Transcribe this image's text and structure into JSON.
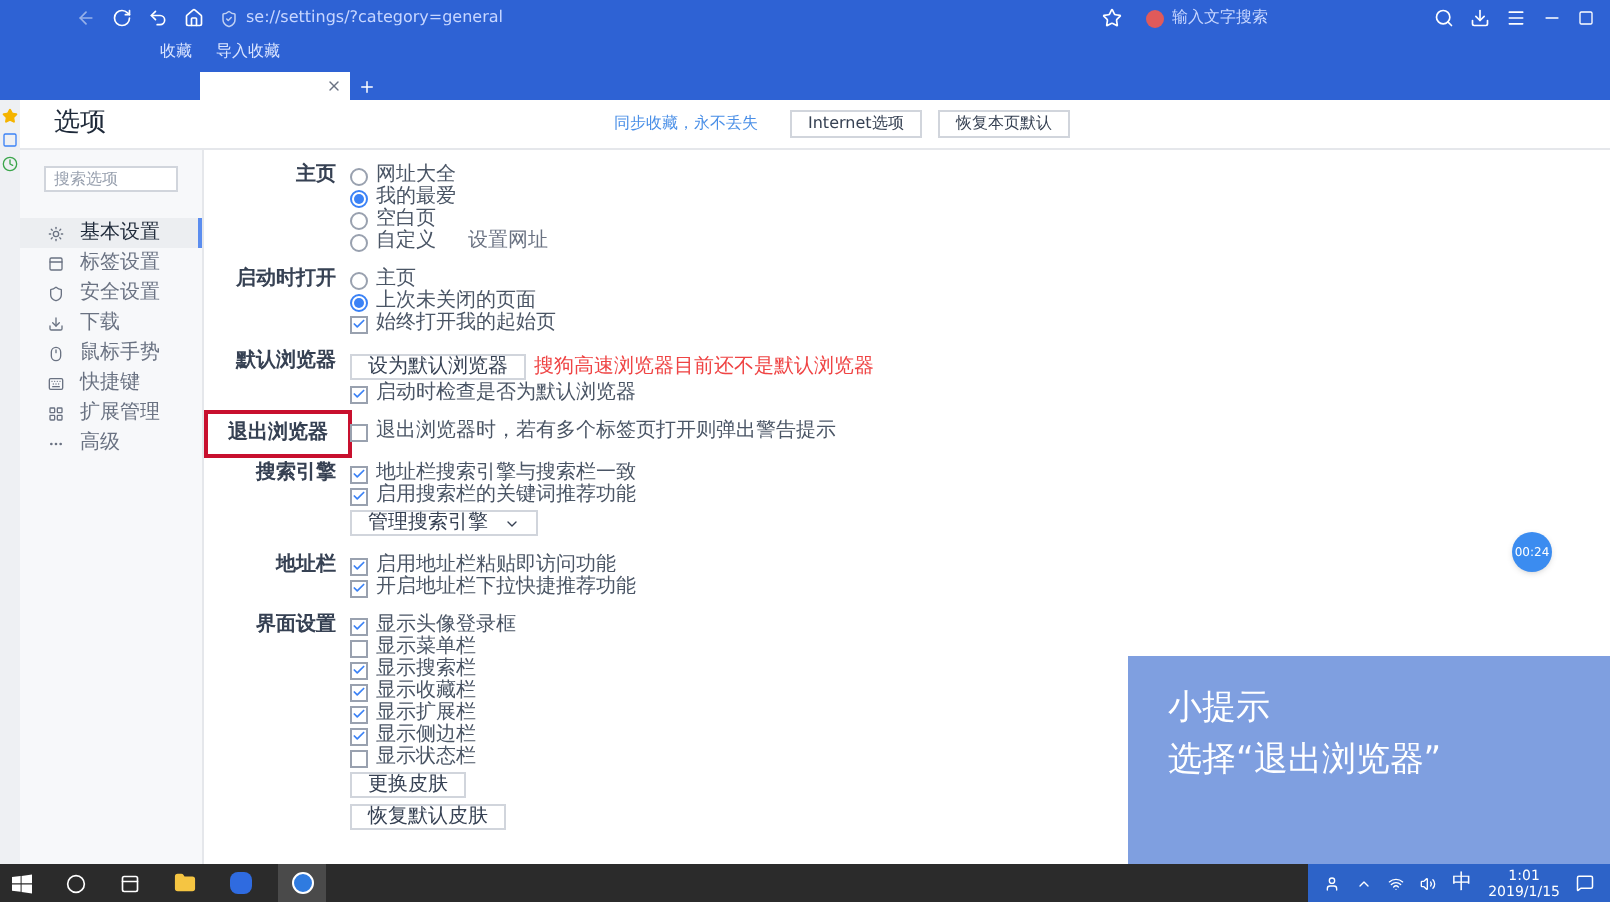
{
  "browser": {
    "url": "se://settings/?category=general",
    "search_placeholder": "输入文字搜索",
    "bookmarks": [
      "收藏",
      "导入收藏"
    ]
  },
  "page": {
    "title": "选项",
    "sync_text": "同步收藏，永不丢失",
    "buttons": [
      "Internet选项",
      "恢复本页默认"
    ]
  },
  "sidebar": {
    "search_placeholder": "搜索选项",
    "items": [
      {
        "label": "基本设置",
        "selected": true
      },
      {
        "label": "标签设置",
        "selected": false
      },
      {
        "label": "安全设置",
        "selected": false
      },
      {
        "label": "下载",
        "selected": false
      },
      {
        "label": "鼠标手势",
        "selected": false
      },
      {
        "label": "快捷键",
        "selected": false
      },
      {
        "label": "扩展管理",
        "selected": false
      },
      {
        "label": "高级",
        "selected": false
      }
    ]
  },
  "sections": [
    {
      "label": "主页",
      "highlighted": false,
      "items": [
        {
          "kind": "radio",
          "label": "网址大全",
          "selected": false
        },
        {
          "kind": "radio",
          "label": "我的最爱",
          "selected": true
        },
        {
          "kind": "radio",
          "label": "空白页",
          "selected": false
        },
        {
          "kind": "radio",
          "label": "自定义",
          "selected": false,
          "link": "设置网址"
        }
      ]
    },
    {
      "label": "启动时打开",
      "highlighted": false,
      "items": [
        {
          "kind": "radio",
          "label": "主页",
          "selected": false
        },
        {
          "kind": "radio",
          "label": "上次未关闭的页面",
          "selected": true
        },
        {
          "kind": "checkbox",
          "label": "始终打开我的起始页",
          "checked": true
        }
      ]
    },
    {
      "label": "默认浏览器",
      "highlighted": false,
      "items": [
        {
          "kind": "button",
          "label": "设为默认浏览器",
          "note": "搜狗高速浏览器目前还不是默认浏览器"
        },
        {
          "kind": "checkbox",
          "label": "启动时检查是否为默认浏览器",
          "checked": true
        }
      ]
    },
    {
      "label": "退出浏览器",
      "highlighted": true,
      "items": [
        {
          "kind": "checkbox",
          "label": "退出浏览器时，若有多个标签页打开则弹出警告提示",
          "checked": false
        }
      ]
    },
    {
      "label": "搜索引擎",
      "highlighted": false,
      "items": [
        {
          "kind": "checkbox",
          "label": "地址栏搜索引擎与搜索栏一致",
          "checked": true
        },
        {
          "kind": "checkbox",
          "label": "启用搜索栏的关键词推荐功能",
          "checked": true
        },
        {
          "kind": "dropdown",
          "label": "管理搜索引擎"
        }
      ]
    },
    {
      "label": "地址栏",
      "highlighted": false,
      "items": [
        {
          "kind": "checkbox",
          "label": "启用地址栏粘贴即访问功能",
          "checked": true
        },
        {
          "kind": "checkbox",
          "label": "开启地址栏下拉快捷推荐功能",
          "checked": true
        }
      ]
    },
    {
      "label": "界面设置",
      "highlighted": false,
      "items": [
        {
          "kind": "checkbox",
          "label": "显示头像登录框",
          "checked": true
        },
        {
          "kind": "checkbox",
          "label": "显示菜单栏",
          "checked": false
        },
        {
          "kind": "checkbox",
          "label": "显示搜索栏",
          "checked": true
        },
        {
          "kind": "checkbox",
          "label": "显示收藏栏",
          "checked": true
        },
        {
          "kind": "checkbox",
          "label": "显示扩展栏",
          "checked": true
        },
        {
          "kind": "checkbox",
          "label": "显示侧边栏",
          "checked": true
        },
        {
          "kind": "checkbox",
          "label": "显示状态栏",
          "checked": false
        },
        {
          "kind": "button",
          "label": "更换皮肤"
        },
        {
          "kind": "button",
          "label": "恢复默认皮肤"
        }
      ]
    }
  ],
  "timer": "00:24",
  "tip": {
    "title": "小提示",
    "text": "选择“退出浏览器”"
  },
  "taskbar": {
    "ime": "中",
    "time": "1:01",
    "date": "2019/1/15"
  }
}
